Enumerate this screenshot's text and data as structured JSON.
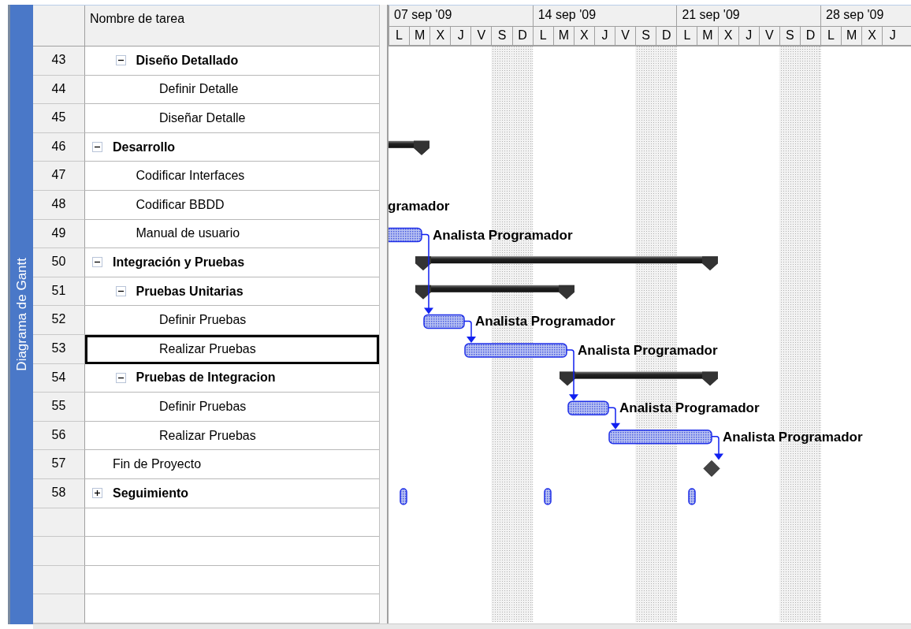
{
  "view_bar": {
    "label": "Diagrama de Gantt"
  },
  "table": {
    "name_column": "Nombre de tarea"
  },
  "timescale": {
    "weeks": [
      {
        "label": "07 sep '09",
        "days": [
          {
            "label": "L",
            "nonworking": false
          },
          {
            "label": "M",
            "nonworking": false
          },
          {
            "label": "X",
            "nonworking": false
          },
          {
            "label": "J",
            "nonworking": false
          },
          {
            "label": "V",
            "nonworking": false
          },
          {
            "label": "S",
            "nonworking": true
          },
          {
            "label": "D",
            "nonworking": true
          }
        ]
      },
      {
        "label": "14 sep '09",
        "days": [
          {
            "label": "L",
            "nonworking": false
          },
          {
            "label": "M",
            "nonworking": false
          },
          {
            "label": "X",
            "nonworking": false
          },
          {
            "label": "J",
            "nonworking": false
          },
          {
            "label": "V",
            "nonworking": false
          },
          {
            "label": "S",
            "nonworking": true
          },
          {
            "label": "D",
            "nonworking": true
          }
        ]
      },
      {
        "label": "21 sep '09",
        "days": [
          {
            "label": "L",
            "nonworking": false
          },
          {
            "label": "M",
            "nonworking": false
          },
          {
            "label": "X",
            "nonworking": false
          },
          {
            "label": "J",
            "nonworking": false
          },
          {
            "label": "V",
            "nonworking": false
          },
          {
            "label": "S",
            "nonworking": true
          },
          {
            "label": "D",
            "nonworking": true
          }
        ]
      },
      {
        "label": "28 sep '09",
        "days": [
          {
            "label": "L",
            "nonworking": false
          },
          {
            "label": "M",
            "nonworking": false
          },
          {
            "label": "X",
            "nonworking": false
          },
          {
            "label": "J",
            "nonworking": false
          }
        ]
      }
    ]
  },
  "rows": [
    {
      "kind": "continued",
      "children": [
        {
          "id": "43",
          "name": "Diseño Detallado",
          "kind": "summary",
          "expanded": true,
          "selected": false,
          "children": [
            {
              "id": "44",
              "name": "Definir Detalle",
              "kind": "task",
              "selected": false
            },
            {
              "id": "45",
              "name": "Diseñar Detalle",
              "kind": "task",
              "selected": false
            }
          ]
        }
      ]
    },
    {
      "id": "46",
      "name": "Desarrollo",
      "kind": "summary",
      "expanded": true,
      "selected": false,
      "children": [
        {
          "id": "47",
          "name": "Codificar Interfaces",
          "kind": "task",
          "selected": false
        },
        {
          "id": "48",
          "name": "Codificar BBDD",
          "kind": "task",
          "selected": false,
          "resource": "gramador"
        },
        {
          "id": "49",
          "name": "Manual de usuario",
          "kind": "task",
          "selected": false,
          "resource": "Analista Programador"
        }
      ]
    },
    {
      "id": "50",
      "name": "Integración y Pruebas",
      "kind": "summary",
      "expanded": true,
      "selected": false,
      "children": [
        {
          "id": "51",
          "name": "Pruebas Unitarias",
          "kind": "summary",
          "expanded": true,
          "selected": false,
          "children": [
            {
              "id": "52",
              "name": "Definir Pruebas",
              "kind": "task",
              "selected": false,
              "resource": "Analista Programador"
            },
            {
              "id": "53",
              "name": "Realizar Pruebas",
              "kind": "task",
              "selected": true,
              "resource": "Analista Programador"
            }
          ]
        },
        {
          "id": "54",
          "name": "Pruebas de Integracion",
          "kind": "summary",
          "expanded": true,
          "selected": false,
          "children": [
            {
              "id": "55",
              "name": "Definir Pruebas",
              "kind": "task",
              "selected": false,
              "resource": "Analista Programador"
            },
            {
              "id": "56",
              "name": "Realizar Pruebas",
              "kind": "task",
              "selected": false,
              "resource": "Analista Programador"
            }
          ]
        }
      ]
    },
    {
      "id": "57",
      "name": "Fin de Proyecto",
      "kind": "milestone",
      "selected": false
    },
    {
      "id": "58",
      "name": "Seguimiento",
      "kind": "recurring",
      "expanded": false,
      "selected": false
    }
  ]
}
